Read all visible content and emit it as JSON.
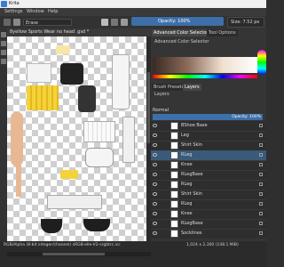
{
  "titlebar": {
    "title": "Krita"
  },
  "menubar": {
    "items": [
      "Settings",
      "Window",
      "Help"
    ]
  },
  "toolbar": {
    "brush_name": "Erase",
    "opacity_label": "Opacity: 100%",
    "size_label": "Size: 7.52 px"
  },
  "document": {
    "tab_title": "8yellow Sports Wear no head .gsd *"
  },
  "panel": {
    "tabs_top": [
      "Advanced Color Selector",
      "Tool Options"
    ],
    "color_selector_title": "Advanced Color Selector",
    "tabs_mid": [
      "Brush Presets",
      "Layers"
    ],
    "layers_title": "Layers",
    "blend_mode": "Normal",
    "opacity": "Opacity: 100%"
  },
  "layers": [
    {
      "name": "BShoe Base",
      "selected": false
    },
    {
      "name": "Leg",
      "selected": false
    },
    {
      "name": "Shirt Skin",
      "selected": false
    },
    {
      "name": "RLeg",
      "selected": true
    },
    {
      "name": "Knee",
      "selected": false
    },
    {
      "name": "RLegBase",
      "selected": false
    },
    {
      "name": "RLeg",
      "selected": false
    },
    {
      "name": "Shirt Skin",
      "selected": false
    },
    {
      "name": "RLeg",
      "selected": false
    },
    {
      "name": "Knee",
      "selected": false
    },
    {
      "name": "RLegBase",
      "selected": false
    },
    {
      "name": "Socklines",
      "selected": false
    }
  ],
  "status": {
    "left": "RGB/Alpha (8-bit integer/channel)  sRGB-elle-V2-srgbtrc.icc",
    "right": "1,024 x 2,300 (148.1 MiB)"
  },
  "colors": {
    "accent": "#3d6fa8",
    "selection": "#3b5a7a",
    "panel": "#353535"
  }
}
